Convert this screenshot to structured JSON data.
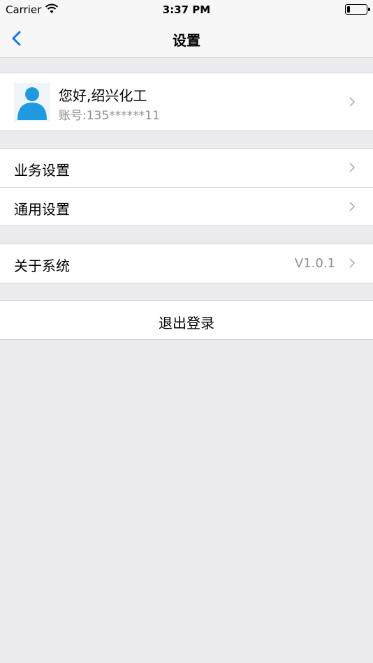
{
  "status_bar": {
    "carrier": "Carrier",
    "time": "3:37 PM"
  },
  "nav": {
    "title": "设置",
    "back_icon": "chevron-left-icon"
  },
  "profile": {
    "greeting": "您好,绍兴化工",
    "account": "账号:135******11"
  },
  "settings": [
    {
      "label": "业务设置"
    },
    {
      "label": "通用设置"
    }
  ],
  "about": {
    "label": "关于系统",
    "version": "V1.0.1"
  },
  "logout": {
    "label": "退出登录"
  },
  "colors": {
    "accent": "#1a73e8",
    "background": "#ebebf0",
    "secondary_text": "#8e8e93",
    "separator": "#d4d4d8"
  }
}
